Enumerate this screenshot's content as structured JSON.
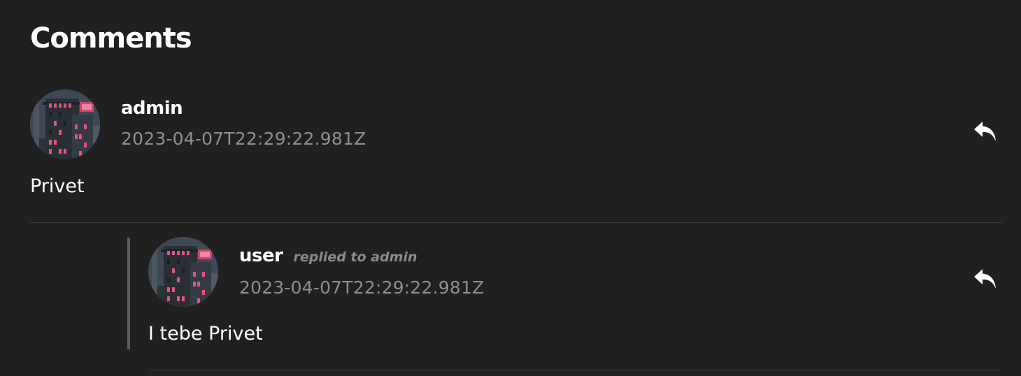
{
  "section": {
    "title": "Comments"
  },
  "comments": [
    {
      "author": "admin",
      "timestamp": "2023-04-07T22:29:22.981Z",
      "body": "Privet",
      "replied_to_text": "",
      "icons": {
        "avatar": "city-building-avatar",
        "reply": "reply-arrow-icon"
      }
    },
    {
      "author": "user",
      "timestamp": "2023-04-07T22:29:22.981Z",
      "body": "I tebe Privet",
      "replied_to_text": "replied to admin",
      "icons": {
        "avatar": "city-building-avatar",
        "reply": "reply-arrow-icon"
      }
    }
  ],
  "colors": {
    "background": "#202020",
    "text": "#ffffff",
    "muted": "#8f8f8f",
    "divider": "#3a3a3a",
    "thread_line": "#5d5d5d",
    "avatar_window": "#e0557d"
  }
}
